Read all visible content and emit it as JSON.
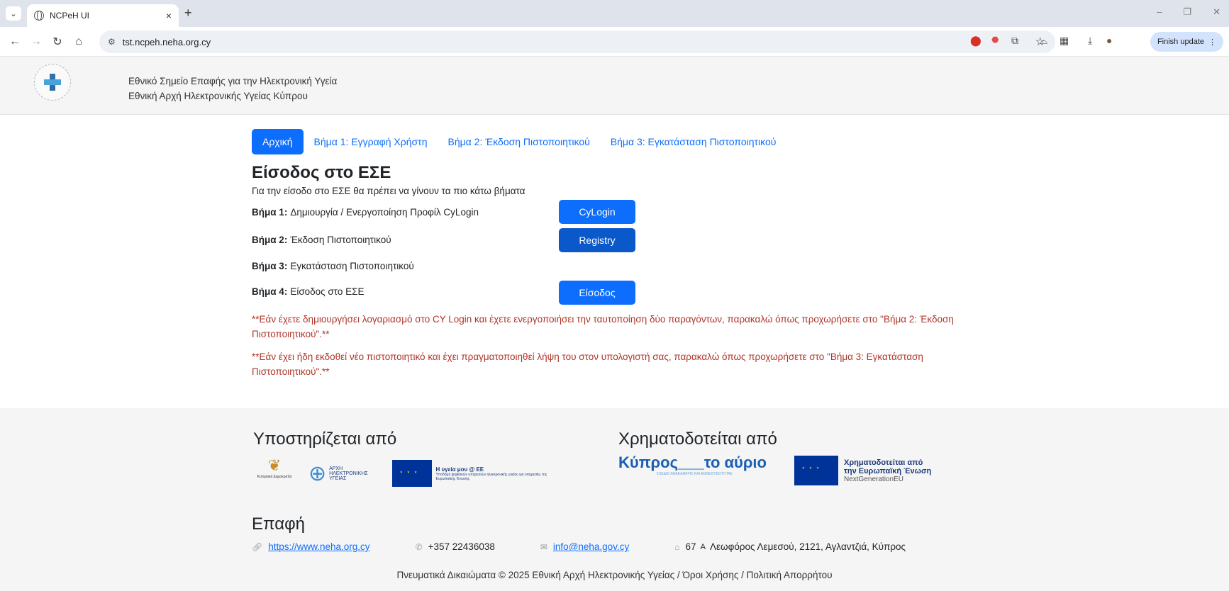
{
  "browser": {
    "tab_title": "NCPeH UI",
    "tab_close": "×",
    "new_tab": "+",
    "url": "tst.ncpeh.neha.org.cy",
    "finish_update": "Finish update"
  },
  "header": {
    "line1": "Εθνικό Σημείο Επαφής για την Ηλεκτρονική Υγεία",
    "line2": "Εθνική Αρχή Ηλεκτρονικής Υγείας Κύπρου",
    "logo_text": "CY"
  },
  "nav": {
    "home": "Αρχική",
    "step1": "Βήμα 1: Εγγραφή Χρήστη",
    "step2": "Βήμα 2: Έκδοση Πιστοποιητικού",
    "step3": "Βήμα 3: Εγκατάσταση Πιστοποιητικού"
  },
  "main": {
    "title": "Είσοδος στο ΕΣΕ",
    "intro": "Για την είσοδο στο ΕΣΕ θα πρέπει να γίνουν τα πιο κάτω βήματα",
    "steps": [
      {
        "label": "Βήμα 1:",
        "text": "Δημιουργία / Ενεργοποίηση Προφίλ CyLogin",
        "button": "CyLogin"
      },
      {
        "label": "Βήμα 2:",
        "text": "Έκδοση Πιστοποιητικού",
        "button": "Registry"
      },
      {
        "label": "Βήμα 3:",
        "text": "Εγκατάσταση Πιστοποιητικού",
        "button": ""
      },
      {
        "label": "Βήμα 4:",
        "text": "Είσοδος στο ΕΣΕ",
        "button": "Είσοδος"
      }
    ],
    "note1": "**Εάν έχετε δημιουργήσει λογαριασμό στο CY Login και έχετε ενεργοποιήσει την ταυτοποίηση δύο παραγόντων, παρακαλώ όπως προχωρήσετε στο \"Βήμα 2: Έκδοση Πιστοποιητικού\".**",
    "note2": "**Εάν έχει ήδη εκδοθεί νέο πιστοποιητικό και έχει πραγματοποιηθεί λήψη του στον υπολογιστή σας, παρακαλώ όπως προχωρήσετε στο \"Βήμα 3: Εγκατάσταση Πιστοποιητικού\".**"
  },
  "footer": {
    "supported_by": "Υποστηρίζεται από",
    "funded_by": "Χρηματοδοτείται από",
    "logo_cy_gov": "Κυπριακή Δημοκρατία",
    "logo_authority": "ΑΡΧΗ ΗΛΕΚΤΡΟΝΙΚΗΣ ΥΓΕΙΑΣ",
    "logo_eu_health_title": "Η υγεία μου @ ΕΕ",
    "logo_eu_health_sub": "Υποδομή ψηφιακών υπηρεσιών ηλεκτρονικής υγείας για υπηρεσίες της Ευρωπαϊκής Ένωσης",
    "logo_kypros": "Κύπρος___το αύριο",
    "logo_kypros_sub": "ΣΧΕΔΙΟ ΑΝΑΚΑΜΨΗΣ ΚΑΙ ΑΝΘΕΚΤΙΚΟΤΗΤΑΣ",
    "logo_eu_funded_1": "Χρηματοδοτείται από",
    "logo_eu_funded_2": "την Ευρωπαϊκή Ένωση",
    "logo_eu_funded_3": "NextGenerationEU",
    "contact_title": "Επαφή",
    "website": "https://www.neha.org.cy",
    "phone": "+357 22436038",
    "email": "info@neha.gov.cy",
    "address_num": "67",
    "address_sup": "Α",
    "address": "Λεωφόρος Λεμεσού, 2121, Αγλαντζιά, Κύπρος",
    "copyright": "Πνευματικά Δικαιώματα © 2025 Εθνική Αρχή Ηλεκτρονικής Υγείας / Όροι Χρήσης / Πολιτική Απορρήτου"
  }
}
